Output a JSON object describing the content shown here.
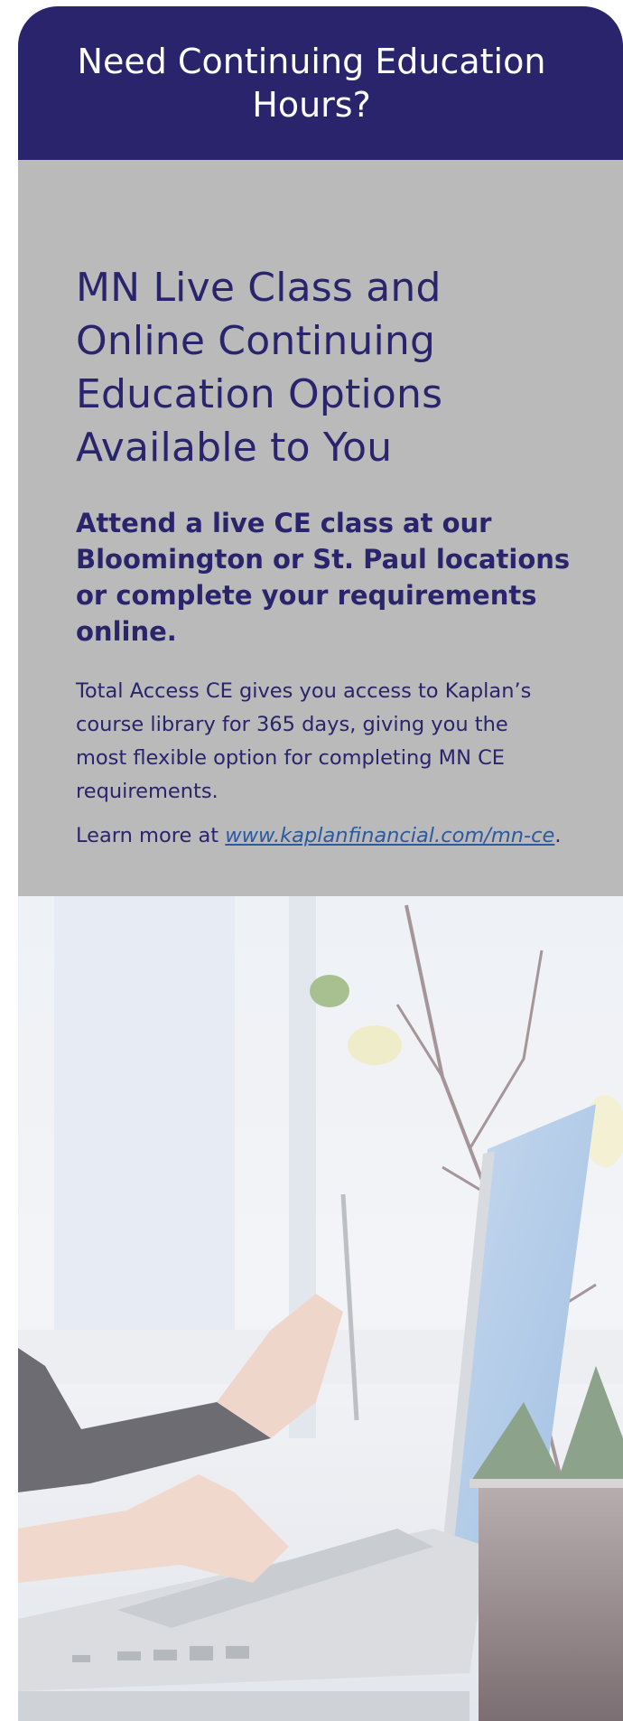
{
  "header": {
    "title": "Need Continuing Education Hours?"
  },
  "content": {
    "headline": "MN Live Class and Online Continuing Education Options Available to You",
    "subhead": "Attend a live CE class at our Bloomington or St. Paul locations or complete your requirements online.",
    "body": "Total Access CE gives you access to Kaplan’s course library for 365 days, giving you the most flexible option for completing MN CE requirements.",
    "learn_more_prefix": "Learn more at ",
    "learn_more_link": "www.kaplanfinancial.com/mn-ce",
    "learn_more_suffix": "."
  },
  "colors": {
    "header_bg": "#29246c",
    "content_bg": "#bababa",
    "text": "#29246c",
    "link": "#2c5aa0"
  },
  "image": {
    "icon": "laptop-photo"
  }
}
